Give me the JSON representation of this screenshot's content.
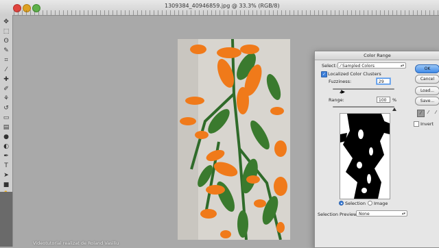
{
  "window": {
    "document_title": "1309384_40946859.jpg @ 33.3% (RGB/8)"
  },
  "toolbar": {
    "tools": [
      "move-tool",
      "marquee-tool",
      "lasso-tool",
      "quick-select-tool",
      "crop-tool",
      "eyedropper-tool",
      "healing-tool",
      "brush-tool",
      "clone-tool",
      "history-brush-tool",
      "eraser-tool",
      "gradient-tool",
      "blur-tool",
      "dodge-tool",
      "pen-tool",
      "type-tool",
      "path-select-tool",
      "shape-tool",
      "hand-tool",
      "zoom-tool"
    ]
  },
  "dialog": {
    "title": "Color Range",
    "select_label": "Select:",
    "select_value": "Sampled Colors",
    "localized_label": "Localized Color Clusters",
    "localized_checked": true,
    "fuzziness_label": "Fuzziness:",
    "fuzziness_value": "29",
    "fuzziness_level": 29,
    "range_label": "Range:",
    "range_value": "100",
    "range_unit": "%",
    "range_level": 100,
    "radio_selection": "Selection",
    "radio_image": "Image",
    "radio_selected": "Selection",
    "selection_preview_label": "Selection Preview:",
    "selection_preview_value": "None",
    "buttons": {
      "ok": "OK",
      "cancel": "Cancel",
      "load": "Load...",
      "save": "Save..."
    },
    "invert_label": "Invert",
    "invert_checked": false
  },
  "footer": {
    "watermark": "Videotutorial realizat de Roland Vasiliu"
  },
  "colors": {
    "canvas_bg": "#a9a9a9",
    "accent": "#3d7fd9",
    "flower_orange": "#f07a1a",
    "leaf_green": "#2f6b2a"
  }
}
